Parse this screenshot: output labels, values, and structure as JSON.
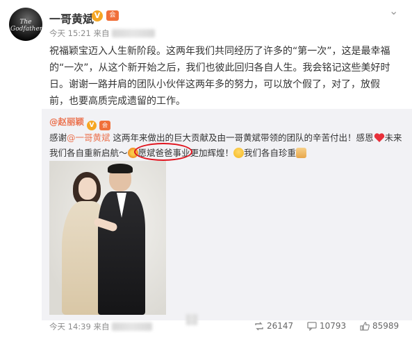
{
  "post": {
    "username": "一哥黄斌",
    "verified_badge": "V",
    "member_badge": "会",
    "avatar_text": "The Godfather",
    "time": "今天 15:21 来自",
    "more_icon": "chevron-down-icon",
    "content": "祝福颖宝迈入人生新阶段。这两年我们共同经历了许多的“第一次”，这是最幸福的“一次”，从这个新开始之后，我们也彼此回归各自人生。我会铭记这些美好时日。谢谢一路并肩的团队小伙伴这两年多的努力，可以放个假了，对了，放假前，也要高质完成遗留的工作。"
  },
  "quoted": {
    "author": "@赵丽颖",
    "verified_badge": "V",
    "member_badge": "会",
    "text_1": "感谢",
    "mention": "@一哥黄斌",
    "text_2": " 这两年来做出的巨大贡献及由一哥黄斌带领的团队的辛苦付出！感恩",
    "text_3": "未来我们各自重新启航～",
    "text_4": "愿斌爸爸事业更加辉煌！",
    "text_5": "我们各自珍重",
    "emojis": [
      "heart-icon",
      "flower-icon",
      "smile-icon",
      "pray-icon"
    ],
    "highlight_color": "#e0141e",
    "link_color": "#eb7350",
    "time": "今天 14:39 来自",
    "stats": {
      "reposts": "26147",
      "comments": "10793",
      "likes": "85989"
    }
  }
}
